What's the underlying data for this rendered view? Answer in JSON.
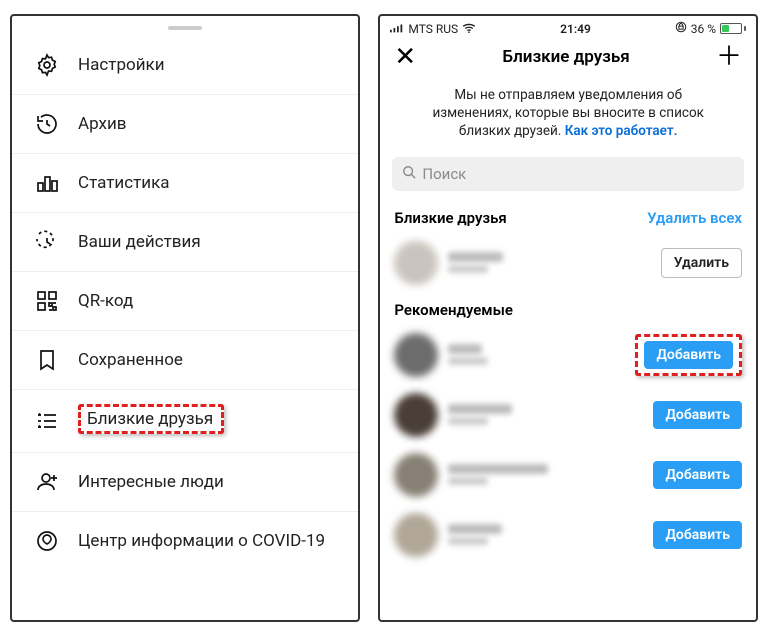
{
  "left": {
    "menu": [
      {
        "id": "settings",
        "label": "Настройки"
      },
      {
        "id": "archive",
        "label": "Архив"
      },
      {
        "id": "stats",
        "label": "Статистика"
      },
      {
        "id": "activity",
        "label": "Ваши действия"
      },
      {
        "id": "qr",
        "label": "QR-код"
      },
      {
        "id": "saved",
        "label": "Сохраненное"
      },
      {
        "id": "close-friends",
        "label": "Близкие друзья"
      },
      {
        "id": "discover",
        "label": "Интересные люди"
      },
      {
        "id": "covid",
        "label": "Центр информации о COVID-19"
      }
    ]
  },
  "right": {
    "status": {
      "carrier": "MTS RUS",
      "time": "21:49",
      "battery_pct": "36 %"
    },
    "header_title": "Близкие друзья",
    "notice_line1": "Мы не отправляем уведомления об",
    "notice_line2": "изменениях, которые вы вносите в список",
    "notice_line3_a": "близких друзей. ",
    "notice_link": "Как это работает.",
    "search_placeholder": "Поиск",
    "section_close_friends": "Близкие друзья",
    "action_remove_all": "Удалить всех",
    "btn_remove": "Удалить",
    "section_recommended": "Рекомендуемые",
    "btn_add": "Добавить"
  }
}
